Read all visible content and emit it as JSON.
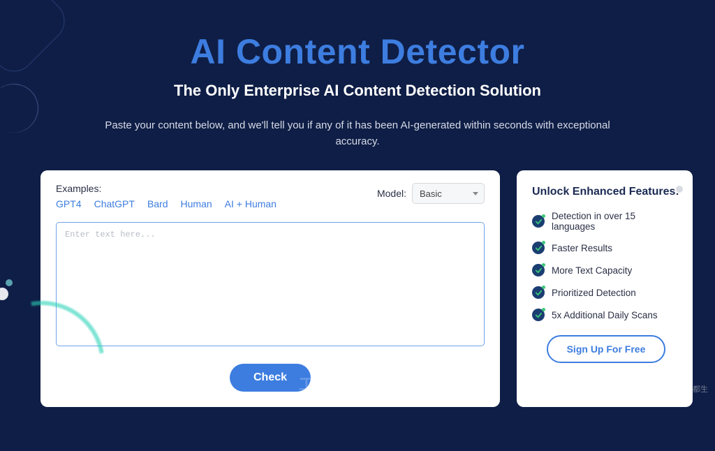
{
  "hero": {
    "title": "AI Content Detector",
    "subtitle": "The Only Enterprise AI Content Detection Solution",
    "description": "Paste your content below, and we'll tell you if any of it has been AI-generated within seconds with exceptional accuracy."
  },
  "main": {
    "examples_label": "Examples:",
    "examples": [
      "GPT4",
      "ChatGPT",
      "Bard",
      "Human",
      "AI + Human"
    ],
    "model_label": "Model:",
    "model_selected": "Basic",
    "textarea_placeholder": "Enter text here...",
    "textarea_value": "",
    "check_button": "Check"
  },
  "side": {
    "title": "Unlock Enhanced Features:",
    "features": [
      "Detection in over 15 languages",
      "Faster Results",
      "More Text Capacity",
      "Prioritized Detection",
      "5x Additional Daily Scans"
    ],
    "signup_button": "Sign Up For Free"
  },
  "watermarks": {
    "center": "工业互联网观察",
    "right": "CSDN @啥都生"
  },
  "colors": {
    "background": "#0f1e46",
    "accent": "#3d7de0",
    "check_badge": "#1a3e72"
  }
}
